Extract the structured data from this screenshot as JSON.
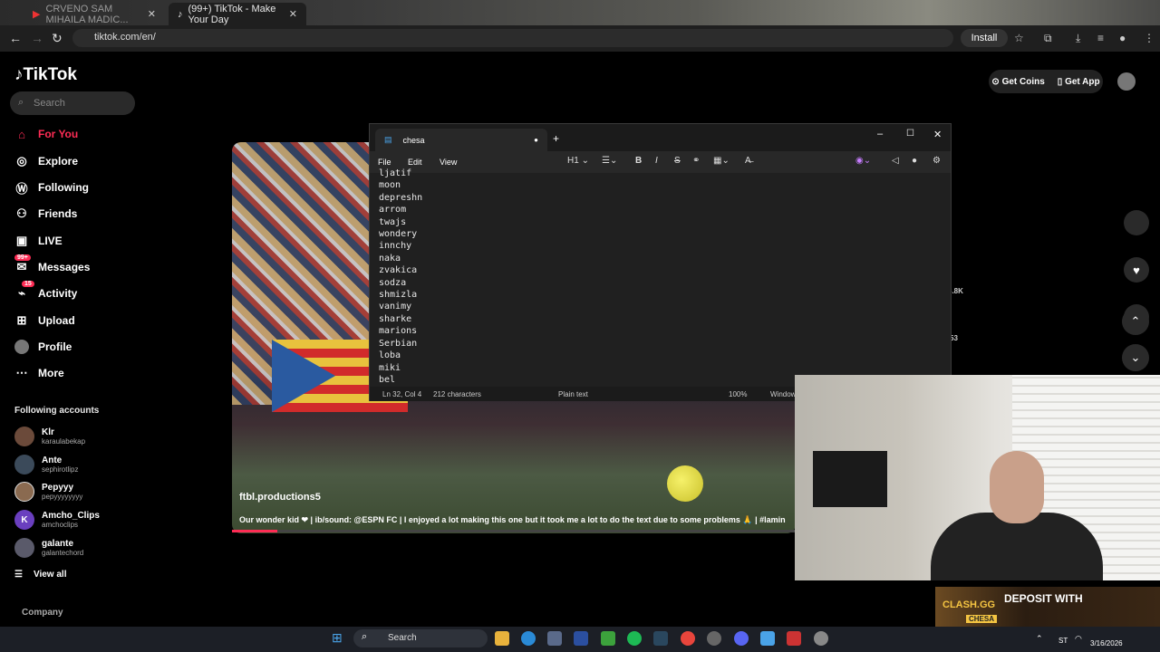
{
  "browser": {
    "tabs": [
      {
        "label": "CRVENO SAM MIHAILA MADIC..."
      },
      {
        "label": "(99+) TikTok - Make Your Day"
      }
    ],
    "url": "tiktok.com/en/",
    "install_label": "Install"
  },
  "tiktok": {
    "logo": "TikTok",
    "search_placeholder": "Search",
    "nav": [
      {
        "label": "For You",
        "icon": "home-icon"
      },
      {
        "label": "Explore",
        "icon": "compass-icon"
      },
      {
        "label": "Following",
        "icon": "following-icon"
      },
      {
        "label": "Friends",
        "icon": "friends-icon"
      },
      {
        "label": "LIVE",
        "icon": "live-icon"
      },
      {
        "label": "Messages",
        "icon": "messages-icon",
        "badge": "99+"
      },
      {
        "label": "Activity",
        "icon": "activity-icon",
        "badge": "15"
      },
      {
        "label": "Upload",
        "icon": "upload-icon"
      },
      {
        "label": "Profile",
        "icon": "avatar"
      },
      {
        "label": "More",
        "icon": "more-icon"
      }
    ],
    "following_title": "Following accounts",
    "accounts": [
      {
        "name": "Klr",
        "handle": "karaulabekap"
      },
      {
        "name": "Ante",
        "handle": "sephirotlipz"
      },
      {
        "name": "Pepyyy",
        "handle": "pepyyyyyyyy"
      },
      {
        "name": "Amcho_Clips",
        "handle": "amchoclips",
        "initial": "K"
      },
      {
        "name": "galante",
        "handle": "galantechord"
      }
    ],
    "view_all": "View all",
    "company": "Company",
    "get_coins": "Get Coins",
    "get_app": "Get App",
    "video": {
      "author": "ftbl.productions5",
      "caption": "Our wonder kid ❤ | ib/sound: @ESPN FC | I enjoyed a lot making this one but it took me a lot to do the text due to some problems 🙏 | #lamin"
    },
    "side_counts": {
      "likes": "8.8K",
      "comments": "53"
    }
  },
  "notepad": {
    "tab_title": "chesa",
    "menus": [
      "File",
      "Edit",
      "View"
    ],
    "heading_selector": "H1",
    "lines": [
      "ljatif",
      "moon",
      "depreshn",
      "arrom",
      "twajs",
      "wondery",
      "innchy",
      "naka",
      "zvakica",
      "sodza",
      "shmizla",
      "vanimy",
      "sharke",
      "marions",
      "Serbian",
      "loba",
      "miki",
      "bel"
    ],
    "status": {
      "position": "Ln 32, Col 4",
      "chars": "212 characters",
      "format": "Plain text",
      "zoom": "100%",
      "line_ending": "Window"
    }
  },
  "banner": {
    "brand": "CLASH.GG",
    "code": "CHESA",
    "cta": "DEPOSIT WITH"
  },
  "taskbar": {
    "search_label": "Search",
    "lang": "ST",
    "time": "",
    "date": "3/16/2026"
  }
}
